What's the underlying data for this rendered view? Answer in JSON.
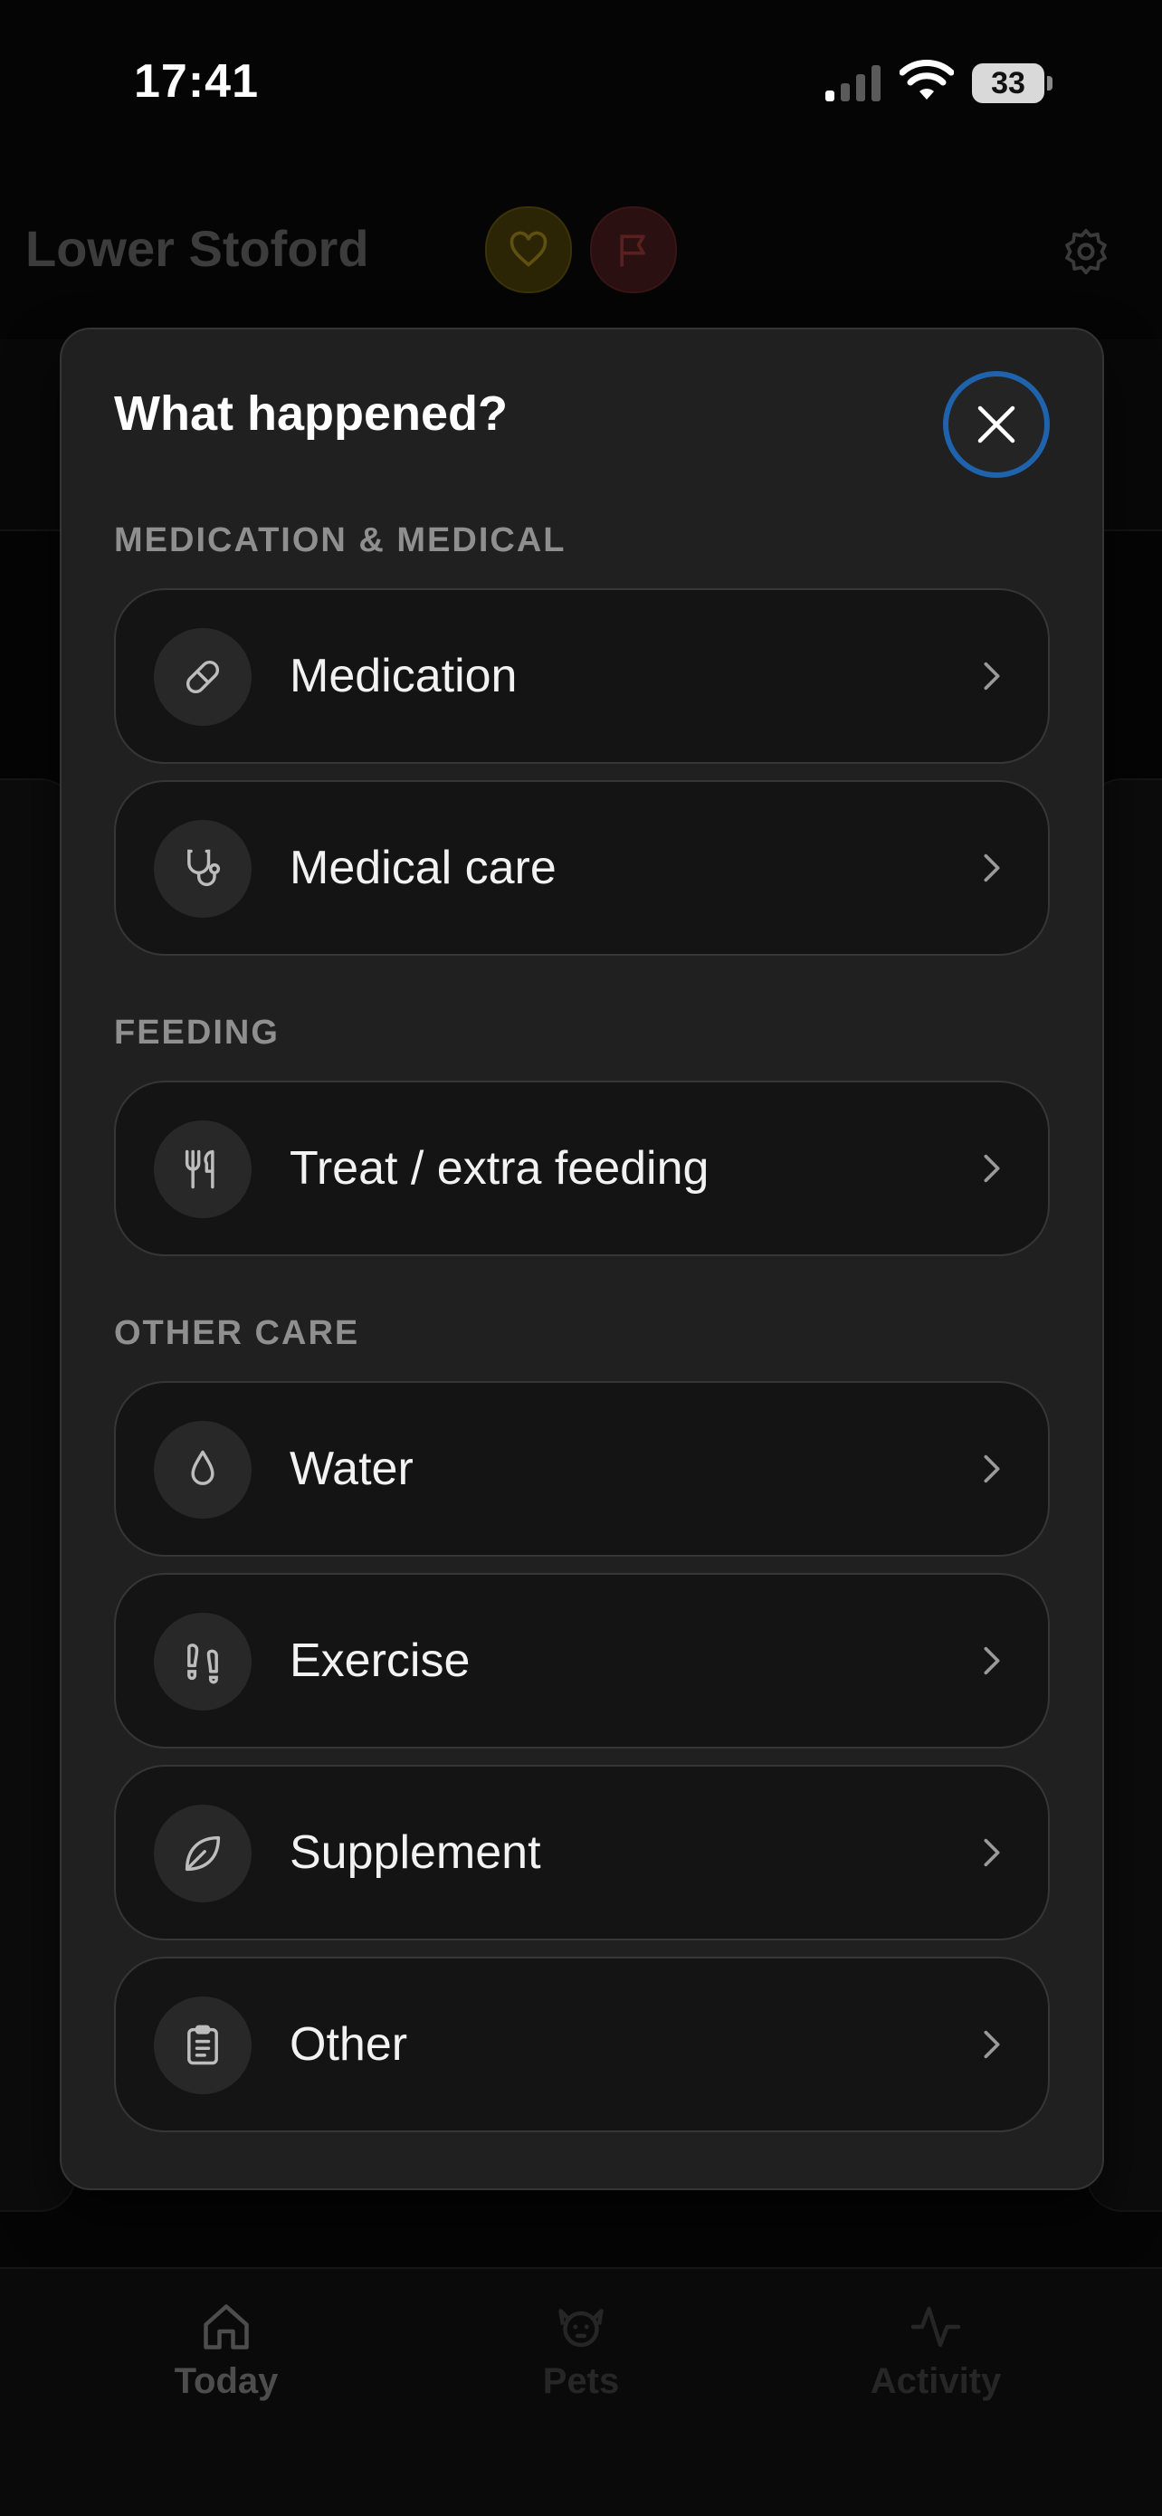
{
  "status_bar": {
    "time": "17:41",
    "battery": "33"
  },
  "header": {
    "title": "Lower Stoford"
  },
  "modal": {
    "title": "What happened?",
    "sections": [
      {
        "title": "MEDICATION & MEDICAL",
        "items": [
          {
            "label": "Medication",
            "icon": "pill-icon"
          },
          {
            "label": "Medical care",
            "icon": "stethoscope-icon"
          }
        ]
      },
      {
        "title": "FEEDING",
        "items": [
          {
            "label": "Treat / extra feeding",
            "icon": "fork-knife-icon"
          }
        ]
      },
      {
        "title": "OTHER CARE",
        "items": [
          {
            "label": "Water",
            "icon": "droplet-icon"
          },
          {
            "label": "Exercise",
            "icon": "footprints-icon"
          },
          {
            "label": "Supplement",
            "icon": "leaf-icon"
          },
          {
            "label": "Other",
            "icon": "clipboard-icon"
          }
        ]
      }
    ]
  },
  "tabs": [
    {
      "label": "Today",
      "icon": "home-icon",
      "active": true
    },
    {
      "label": "Pets",
      "icon": "dog-icon",
      "active": false
    },
    {
      "label": "Activity",
      "icon": "pulse-icon",
      "active": false
    }
  ],
  "colors": {
    "accent_ring": "#1f63ad",
    "modal_bg": "#202020",
    "option_bg": "#141414",
    "section_header": "#8f8f8f"
  }
}
